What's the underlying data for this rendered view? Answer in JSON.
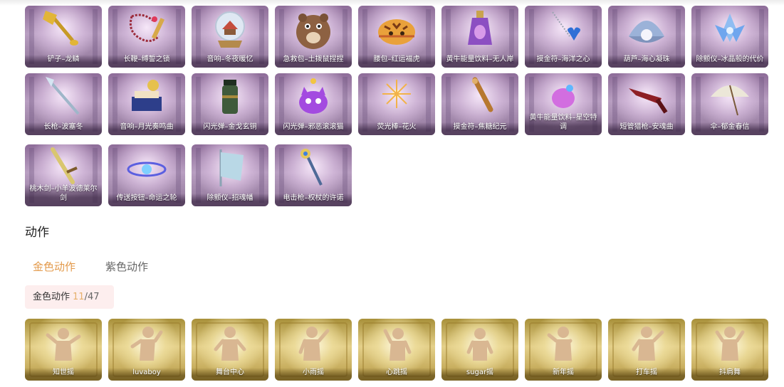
{
  "items_row1": [
    {
      "label": "铲子–龙鳞",
      "icon": "golden-shovel-icon"
    },
    {
      "label": "长鞭–缚誓之锁",
      "icon": "red-chain-whip-icon"
    },
    {
      "label": "音响–冬夜暖忆",
      "icon": "snow-globe-icon"
    },
    {
      "label": "急救包–土拨鼠捏捏",
      "icon": "groundhog-plush-icon"
    },
    {
      "label": "腰包–红运福虎",
      "icon": "tiger-pouch-icon"
    },
    {
      "label": "黄牛能量饮料–无人岸",
      "icon": "energy-drink-bottle-icon"
    },
    {
      "label": "摸金符–海洋之心",
      "icon": "heart-pendant-icon"
    },
    {
      "label": "葫芦–海心凝珠",
      "icon": "pearl-shell-icon"
    },
    {
      "label": "除颤仪–冰晶般的代价",
      "icon": "ice-crystal-lotus-icon"
    }
  ],
  "items_row2": [
    {
      "label": "长枪–波塞冬",
      "icon": "trident-spear-icon"
    },
    {
      "label": "音响–月光奏鸣曲",
      "icon": "music-box-icon"
    },
    {
      "label": "闪光弹–金戈玄铜",
      "icon": "bronze-grenade-icon"
    },
    {
      "label": "闪光弹–邪恶滚滚猫",
      "icon": "purple-cat-bomb-icon"
    },
    {
      "label": "荧光棒–花火",
      "icon": "firework-sparkler-icon"
    },
    {
      "label": "摸金符–焦糖纪元",
      "icon": "caramel-amulet-icon"
    },
    {
      "label": "黄牛能量饮料–星空特调",
      "icon": "star-drink-icon"
    },
    {
      "label": "短管猎枪–安魂曲",
      "icon": "red-shotgun-icon"
    },
    {
      "label": "伞–郁金春信",
      "icon": "paper-umbrella-icon"
    }
  ],
  "items_row3": [
    {
      "label": "桃木剑–小羊波德莱尔剑",
      "icon": "wooden-sword-icon"
    },
    {
      "label": "传送按钮–命运之轮",
      "icon": "teleport-wheel-icon"
    },
    {
      "label": "除颤仪–招魂幡",
      "icon": "spirit-banner-icon"
    },
    {
      "label": "电击枪–权杖的许诺",
      "icon": "scepter-icon"
    }
  ],
  "actions_section": {
    "title": "动作",
    "tabs": [
      {
        "label": "金色动作"
      },
      {
        "label": "紫色动作"
      }
    ],
    "counter": {
      "label": "金色动作",
      "current": "11",
      "total": "/47"
    }
  },
  "gold_actions": [
    {
      "label": "知世摇",
      "icon": "pose-figure-icon"
    },
    {
      "label": "luvaboy",
      "icon": "pose-figure-icon"
    },
    {
      "label": "舞台中心",
      "icon": "pose-figure-icon"
    },
    {
      "label": "小雨摇",
      "icon": "pose-figure-icon"
    },
    {
      "label": "心跳摇",
      "icon": "pose-figure-icon"
    },
    {
      "label": "sugar摇",
      "icon": "pose-figure-icon"
    },
    {
      "label": "新年摇",
      "icon": "pose-figure-icon"
    },
    {
      "label": "打车摇",
      "icon": "pose-figure-icon"
    },
    {
      "label": "抖肩舞",
      "icon": "pose-figure-icon"
    }
  ],
  "colors": {
    "accent": "#e39a4b",
    "counter_bg": "#fdeeee",
    "counter_num": "#e6b06b"
  }
}
